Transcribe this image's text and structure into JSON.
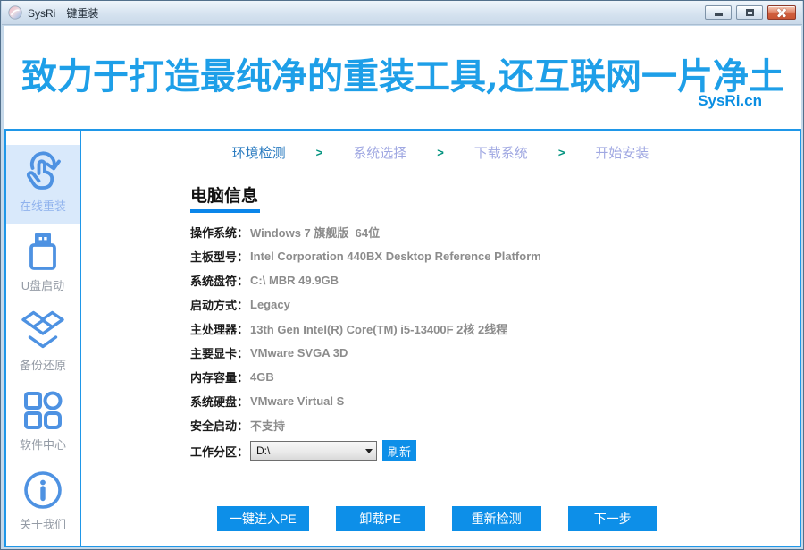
{
  "window": {
    "title": "SysRi一键重装"
  },
  "header": {
    "slogan": "致力于打造最纯净的重装工具,还互联网一片净土",
    "site": "SysRi.cn"
  },
  "sidebar": {
    "items": [
      {
        "label": "在线重装",
        "icon": "hand-refresh-icon",
        "active": true
      },
      {
        "label": "U盘启动",
        "icon": "usb-drive-icon",
        "active": false
      },
      {
        "label": "备份还原",
        "icon": "backup-box-icon",
        "active": false
      },
      {
        "label": "软件中心",
        "icon": "app-grid-icon",
        "active": false
      },
      {
        "label": "关于我们",
        "icon": "info-circle-icon",
        "active": false
      }
    ]
  },
  "steps": {
    "separator": ">",
    "items": [
      {
        "label": "环境检测",
        "active": true
      },
      {
        "label": "系统选择",
        "active": false
      },
      {
        "label": "下载系统",
        "active": false
      },
      {
        "label": "开始安装",
        "active": false
      }
    ]
  },
  "main": {
    "section_title": "电脑信息",
    "info_rows": [
      {
        "label": "操作系统：",
        "value": "Windows 7 旗舰版  64位"
      },
      {
        "label": "主板型号：",
        "value": "Intel Corporation 440BX Desktop Reference Platform"
      },
      {
        "label": "系统盘符：",
        "value": "C:\\ MBR 49.9GB"
      },
      {
        "label": "启动方式：",
        "value": "Legacy"
      },
      {
        "label": "主处理器：",
        "value": "13th Gen Intel(R) Core(TM) i5-13400F 2核 2线程"
      },
      {
        "label": "主要显卡：",
        "value": "VMware SVGA 3D"
      },
      {
        "label": "内存容量：",
        "value": "4GB"
      },
      {
        "label": "系统硬盘：",
        "value": "VMware Virtual S"
      },
      {
        "label": "安全启动：",
        "value": "不支持"
      }
    ],
    "partition": {
      "label": "工作分区：",
      "selected": "D:\\",
      "refresh_label": "刷新"
    }
  },
  "footer": {
    "buttons": [
      {
        "label": "一键进入PE"
      },
      {
        "label": "卸载PE"
      },
      {
        "label": "重新检测"
      },
      {
        "label": "下一步"
      }
    ]
  },
  "colors": {
    "accent_blue": "#0D8FE8",
    "border_blue": "#1F97E8",
    "icon_blue": "#4E92E2",
    "slogan_blue": "#1E9FE8",
    "step_active": "#2A7BC0",
    "step_inactive": "#A0A8E2",
    "step_separator": "#00927E",
    "value_gray": "#8C8C8C"
  }
}
